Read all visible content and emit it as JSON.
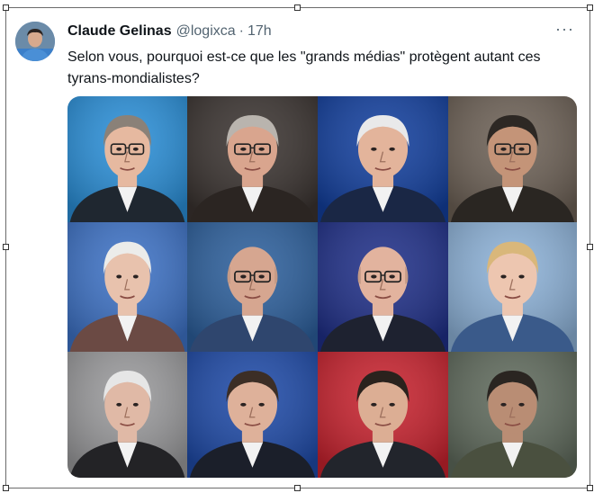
{
  "tweet": {
    "author_name": "Claude Gelinas",
    "author_handle": "@logixca",
    "separator": "·",
    "time": "17h",
    "text": "Selon vous, pourquoi est-ce que les \"grands médias\" protègent autant ces tyrans-mondialistes?",
    "more_icon": "more-horizontal-icon",
    "more_glyph": "···"
  },
  "media": {
    "tiles": [
      {
        "bg": "#2a8fd8",
        "skin": "#e6b9a0",
        "hair": "#8a8178",
        "suit": "#1f2730",
        "glasses": true,
        "bald": false
      },
      {
        "bg": "#3a3330",
        "skin": "#d9a58e",
        "hair": "#b9b4ae",
        "suit": "#2b2522",
        "glasses": true,
        "bald": false
      },
      {
        "bg": "#123f9e",
        "skin": "#e3b49b",
        "hair": "#e9e9ea",
        "suit": "#1a2745",
        "glasses": false,
        "bald": false
      },
      {
        "bg": "#6d6156",
        "skin": "#c49478",
        "hair": "#2d2824",
        "suit": "#2a2622",
        "glasses": true,
        "bald": false
      },
      {
        "bg": "#3d72c6",
        "skin": "#e8c2ad",
        "hair": "#ececea",
        "suit": "#6b4a44",
        "glasses": false,
        "bald": false
      },
      {
        "bg": "#2c5f9c",
        "skin": "#d6a690",
        "hair": "#d6a690",
        "suit": "#2f466e",
        "glasses": true,
        "bald": true
      },
      {
        "bg": "#1f2f88",
        "skin": "#e2b39e",
        "hair": "#e2b39e",
        "suit": "#1e2230",
        "glasses": true,
        "bald": true
      },
      {
        "bg": "#8db2d8",
        "skin": "#edc6b0",
        "hair": "#d9b77a",
        "suit": "#3a5a8a",
        "glasses": false,
        "bald": false
      },
      {
        "bg": "#9a9a9c",
        "skin": "#e0b9a6",
        "hair": "#e6e6e6",
        "suit": "#232326",
        "glasses": false,
        "bald": false
      },
      {
        "bg": "#1e4aa8",
        "skin": "#deb19a",
        "hair": "#3c2e26",
        "suit": "#1b1f2a",
        "glasses": false,
        "bald": false
      },
      {
        "bg": "#c8222e",
        "skin": "#dcae94",
        "hair": "#2a221d",
        "suit": "#22252c",
        "glasses": false,
        "bald": false
      },
      {
        "bg": "#5f6a5c",
        "skin": "#b98d74",
        "hair": "#2a2521",
        "suit": "#4a503f",
        "glasses": false,
        "bald": false
      }
    ]
  }
}
